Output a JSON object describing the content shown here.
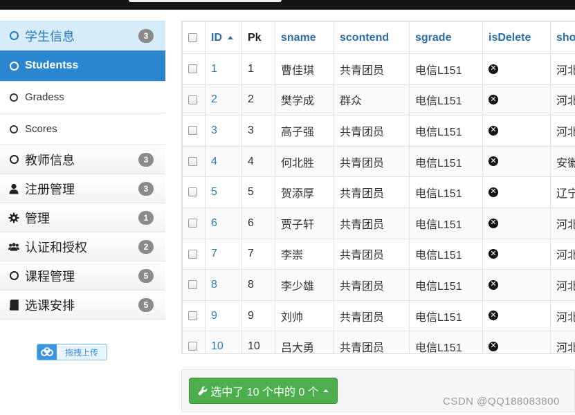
{
  "sidebar": {
    "items": [
      {
        "label": "学生信息",
        "badge": "3",
        "icon": "circle-icon",
        "state": "header-active"
      },
      {
        "label": "Studentss",
        "badge": "",
        "icon": "circle-icon",
        "state": "selected"
      },
      {
        "label": "Gradess",
        "badge": "",
        "icon": "circle-icon",
        "state": "sub"
      },
      {
        "label": "Scores",
        "badge": "",
        "icon": "circle-icon",
        "state": "sub"
      },
      {
        "label": "教师信息",
        "badge": "3",
        "icon": "circle-icon",
        "state": "normal"
      },
      {
        "label": "注册管理",
        "badge": "3",
        "icon": "user-icon",
        "state": "normal"
      },
      {
        "label": "管理",
        "badge": "1",
        "icon": "gear-icon",
        "state": "normal"
      },
      {
        "label": "认证和授权",
        "badge": "2",
        "icon": "users-icon",
        "state": "normal"
      },
      {
        "label": "课程管理",
        "badge": "5",
        "icon": "circle-icon",
        "state": "normal"
      },
      {
        "label": "选课安排",
        "badge": "5",
        "icon": "book-icon",
        "state": "normal"
      }
    ],
    "upload_label": "拖拽上传"
  },
  "table": {
    "columns": [
      "ID",
      "Pk",
      "sname",
      "scontend",
      "sgrade",
      "isDelete",
      "sho"
    ],
    "rows": [
      {
        "id": "1",
        "pk": "1",
        "sname": "曹佳琪",
        "scontend": "共青团员",
        "sgrade": "电信L151",
        "sho": "河北"
      },
      {
        "id": "2",
        "pk": "2",
        "sname": "樊学成",
        "scontend": "群众",
        "sgrade": "电信L151",
        "sho": "河北"
      },
      {
        "id": "3",
        "pk": "3",
        "sname": "高子强",
        "scontend": "共青团员",
        "sgrade": "电信L151",
        "sho": "河北"
      },
      {
        "id": "4",
        "pk": "4",
        "sname": "何北胜",
        "scontend": "共青团员",
        "sgrade": "电信L151",
        "sho": "安徽"
      },
      {
        "id": "5",
        "pk": "5",
        "sname": "贺添厚",
        "scontend": "共青团员",
        "sgrade": "电信L151",
        "sho": "辽宁"
      },
      {
        "id": "6",
        "pk": "6",
        "sname": "贾子轩",
        "scontend": "共青团员",
        "sgrade": "电信L151",
        "sho": "河北"
      },
      {
        "id": "7",
        "pk": "7",
        "sname": "李崇",
        "scontend": "共青团员",
        "sgrade": "电信L151",
        "sho": "河北"
      },
      {
        "id": "8",
        "pk": "8",
        "sname": "李少雄",
        "scontend": "共青团员",
        "sgrade": "电信L151",
        "sho": "河北"
      },
      {
        "id": "9",
        "pk": "9",
        "sname": "刘帅",
        "scontend": "共青团员",
        "sgrade": "电信L151",
        "sho": "河北"
      },
      {
        "id": "10",
        "pk": "10",
        "sname": "吕大勇",
        "scontend": "共青团员",
        "sgrade": "电信L151",
        "sho": "河北"
      }
    ]
  },
  "footer": {
    "selection_label": "选中了 10 个中的 0 个",
    "watermark": "CSDN @QQ188083800"
  },
  "colors": {
    "accent": "#2b86d0",
    "success": "#4cae4c",
    "badge": "#8a8a8a"
  }
}
